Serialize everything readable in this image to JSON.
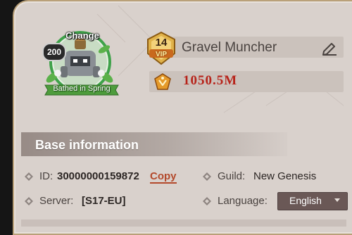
{
  "profile": {
    "avatar_button": "Change",
    "level": "200",
    "title": "Bathed in Spring",
    "vip_level": "14",
    "vip_text": "VIP",
    "name": "Gravel Muncher",
    "power": "1050.5M"
  },
  "base_info": {
    "heading": "Base information",
    "id_label": "ID:",
    "id_value": "30000000159872",
    "copy_label": "Copy",
    "guild_label": "Guild:",
    "guild_value": "New Genesis",
    "server_label": "Server:",
    "server_value": "[S17-EU]",
    "language_label": "Language:",
    "language_value": "English"
  },
  "icons": {
    "edit": "pencil-icon",
    "power": "power-crest-icon",
    "bullet": "diamond-bullet-icon",
    "dropdown": "chevron-down-icon"
  },
  "colors": {
    "panel": "#d9d1cc",
    "power_text": "#b7241b",
    "copy_link": "#b3492b",
    "dropdown_bg": "#6a5856",
    "vip_gold": "#e0b24a"
  }
}
